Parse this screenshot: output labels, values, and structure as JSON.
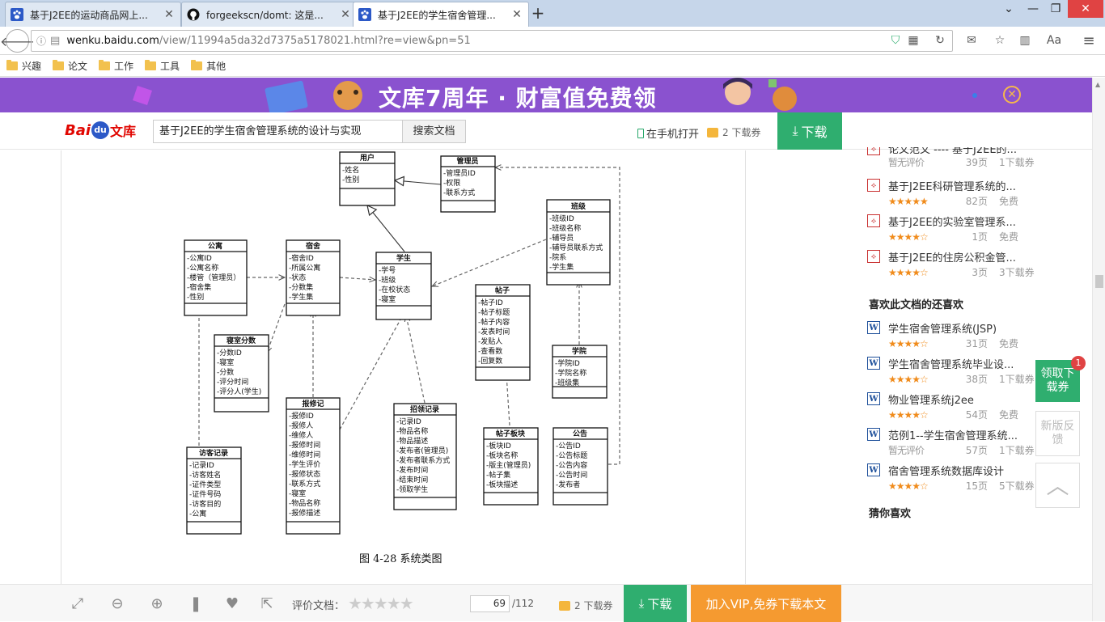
{
  "tabs": [
    {
      "title": "基于J2EE的运动商品网上...",
      "favicon": "paw-icon"
    },
    {
      "title": "forgeekscn/domt: 这是...",
      "favicon": "github-icon"
    },
    {
      "title": "基于J2EE的学生宿舍管理...",
      "favicon": "paw-icon"
    }
  ],
  "url": {
    "host": "wenku.baidu.com",
    "path": "/view/11994a5da32d7375a5178021.html?re=view&pn=51"
  },
  "bookmarks": [
    "兴趣",
    "论文",
    "工作",
    "工具",
    "其他"
  ],
  "banner": {
    "slogan": "文库7周年 · 财富值免费领"
  },
  "header": {
    "logo_bai": "Bai",
    "logo_du": "du",
    "logo_wenku": "文库",
    "search_value": "基于J2EE的学生宿舍管理系统的设计与实现",
    "search_button": "搜索文档",
    "mobile_open": "在手机打开",
    "coupon_count": "2 下载券",
    "download": "下载"
  },
  "document": {
    "caption": "图 4-28 系统类图",
    "uml_classes": [
      {
        "name": "用户",
        "attrs": [
          "-姓名",
          "-性别"
        ]
      },
      {
        "name": "管理员",
        "attrs": [
          "-管理员ID",
          "-权限",
          "-联系方式"
        ]
      },
      {
        "name": "班级",
        "attrs": [
          "-班级ID",
          "-班级名称",
          "-辅导员",
          "-辅导员联系方式",
          "-院系",
          "-学生集"
        ]
      },
      {
        "name": "公寓",
        "attrs": [
          "-公寓ID",
          "-公寓名称",
          "-楼管（管理员）",
          "-宿舍集",
          "-性别"
        ]
      },
      {
        "name": "宿舍",
        "attrs": [
          "-宿舍ID",
          "-所属公寓",
          "-状态",
          "-分数集",
          "-学生集"
        ]
      },
      {
        "name": "学生",
        "attrs": [
          "-学号",
          "-班级",
          "-在校状态",
          "-寝室"
        ]
      },
      {
        "name": "帖子",
        "attrs": [
          "-帖子ID",
          "-帖子标题",
          "-帖子内容",
          "-发表时间",
          "-发贴人",
          "-查看数",
          "-回复数"
        ]
      },
      {
        "name": "寝室分数",
        "attrs": [
          "-分数ID",
          "-寝室",
          "-分数",
          "-评分时间",
          "-评分人(学生)"
        ]
      },
      {
        "name": "学院",
        "attrs": [
          "-学院ID",
          "-学院名称",
          "-班级集"
        ]
      },
      {
        "name": "报修记",
        "attrs": [
          "-报修ID",
          "-报修人",
          "-维修人",
          "-报修时间",
          "-维修时间",
          "-学生评价",
          "-报修状态",
          "-联系方式",
          "-寝室",
          "-物品名称",
          "-报修描述"
        ]
      },
      {
        "name": "招领记录",
        "attrs": [
          "-记录ID",
          "-物品名称",
          "-物品描述",
          "-发布者(管理员)",
          "-发布者联系方式",
          "-发布时间",
          "-结束时间",
          "-领取学生"
        ]
      },
      {
        "name": "访客记录",
        "attrs": [
          "-记录ID",
          "-访客姓名",
          "-证件类型",
          "-证件号码",
          "-访客目的",
          "-公寓"
        ]
      },
      {
        "name": "帖子板块",
        "attrs": [
          "-板块ID",
          "-板块名称",
          "-版主(管理员)",
          "-帖子集",
          "-板块描述"
        ]
      },
      {
        "name": "公告",
        "attrs": [
          "-公告ID",
          "-公告标题",
          "-公告内容",
          "-公告时间",
          "-发布者"
        ]
      }
    ]
  },
  "sidebar": {
    "related_partial": {
      "title": "论文范文 ---- 基于J2EE的...",
      "rating": "暂无评价",
      "pages": "39页",
      "price": "1下载券"
    },
    "related": [
      {
        "title": "基于J2EE科研管理系统的...",
        "stars": "★★★★★",
        "pages": "82页",
        "price": "免费",
        "icon": "pdf-icon"
      },
      {
        "title": "基于J2EE的实验室管理系...",
        "stars": "★★★★☆",
        "pages": "1页",
        "price": "免费",
        "icon": "pdf-icon"
      },
      {
        "title": "基于J2EE的住房公积金管...",
        "stars": "★★★★☆",
        "pages": "3页",
        "price": "3下载券",
        "icon": "pdf-icon"
      }
    ],
    "also_like_title": "喜欢此文档的还喜欢",
    "also_like": [
      {
        "title": "学生宿舍管理系统(JSP)",
        "stars": "★★★★☆",
        "pages": "31页",
        "price": "免费"
      },
      {
        "title": "学生宿舍管理系统毕业设...",
        "stars": "★★★★☆",
        "pages": "38页",
        "price": "1下载券"
      },
      {
        "title": "物业管理系统j2ee",
        "stars": "★★★★☆",
        "pages": "54页",
        "price": "免费"
      },
      {
        "title": "范例1--学生宿舍管理系统...",
        "rating": "暂无评价",
        "pages": "57页",
        "price": "1下载券"
      },
      {
        "title": "宿舍管理系统数据库设计",
        "stars": "★★★★☆",
        "pages": "15页",
        "price": "5下载券"
      }
    ],
    "guess_title": "猜你喜欢"
  },
  "float_buttons": {
    "coupon": "领取下载券",
    "badge": "1",
    "feedback": "新版反馈"
  },
  "bottombar": {
    "rate_label": "评价文档：",
    "rate_stars": "★★★★★",
    "page_current": "69",
    "page_total": "/112",
    "coupon": "2 下载券",
    "download": "下载",
    "vip": "加入VIP,免券下载本文"
  }
}
